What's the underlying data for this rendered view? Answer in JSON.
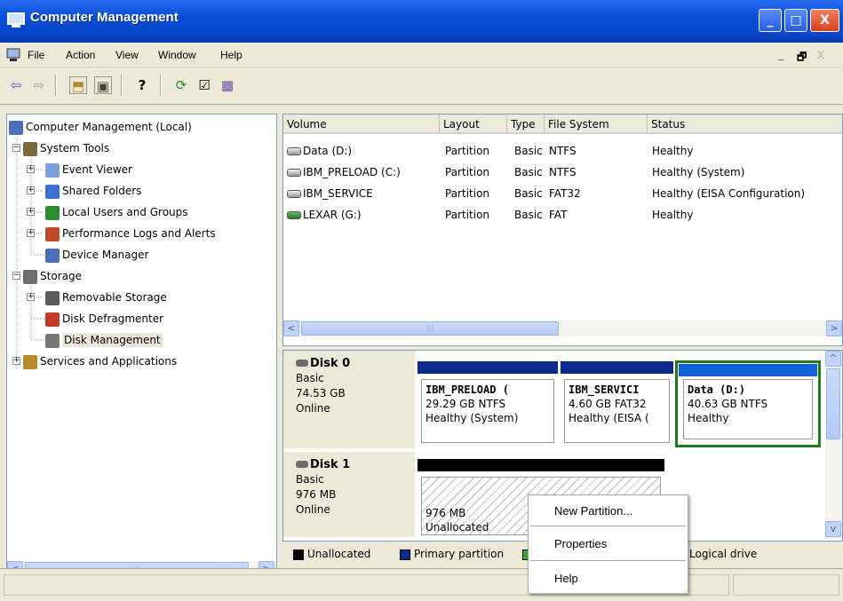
{
  "window": {
    "title": "Computer Management",
    "minimize": "_",
    "maximize": "□",
    "close": "X"
  },
  "menubar": {
    "items": [
      "File",
      "Action",
      "View",
      "Window",
      "Help"
    ],
    "mdi_min": "_",
    "mdi_restore": "🗗",
    "mdi_close": "X"
  },
  "toolbar": {
    "back": "⇦",
    "forward": "⇨",
    "up": "⬒",
    "show_hide": "▣",
    "help": "?",
    "refresh": "⟳",
    "properties": "☑",
    "disk": "▦"
  },
  "tree": {
    "items": [
      {
        "label": "Computer Management (Local)",
        "icon": "computer-icon",
        "color": "#4a6fb5"
      },
      {
        "label": "System Tools",
        "icon": "tools-icon",
        "color": "#7b6a3c"
      },
      {
        "label": "Event Viewer",
        "icon": "event-viewer-icon",
        "color": "#7aa2d8"
      },
      {
        "label": "Shared Folders",
        "icon": "shared-folder-icon",
        "color": "#3b6fd1"
      },
      {
        "label": "Local Users and Groups",
        "icon": "users-icon",
        "color": "#2e8a2e"
      },
      {
        "label": "Performance Logs and Alerts",
        "icon": "performance-icon",
        "color": "#c04a2a"
      },
      {
        "label": "Device Manager",
        "icon": "device-manager-icon",
        "color": "#4a6fb5"
      },
      {
        "label": "Storage",
        "icon": "storage-icon",
        "color": "#6d6d6d"
      },
      {
        "label": "Removable Storage",
        "icon": "removable-storage-icon",
        "color": "#5a5a5a"
      },
      {
        "label": "Disk Defragmenter",
        "icon": "defrag-icon",
        "color": "#c0392b"
      },
      {
        "label": "Disk Management",
        "icon": "disk-management-icon",
        "color": "#777"
      },
      {
        "label": "Services and Applications",
        "icon": "services-icon",
        "color": "#b58a2a"
      }
    ]
  },
  "volumes": {
    "columns": [
      "Volume",
      "Layout",
      "Type",
      "File System",
      "Status"
    ],
    "rows": [
      {
        "volume": "Data (D:)",
        "layout": "Partition",
        "type": "Basic",
        "fs": "NTFS",
        "status": "Healthy"
      },
      {
        "volume": "IBM_PRELOAD (C:)",
        "layout": "Partition",
        "type": "Basic",
        "fs": "NTFS",
        "status": "Healthy (System)"
      },
      {
        "volume": "IBM_SERVICE",
        "layout": "Partition",
        "type": "Basic",
        "fs": "FAT32",
        "status": "Healthy (EISA Configuration)"
      },
      {
        "volume": "LEXAR (G:)",
        "layout": "Partition",
        "type": "Basic",
        "fs": "FAT",
        "status": "Healthy"
      }
    ]
  },
  "disks": [
    {
      "name": "Disk 0",
      "type": "Basic",
      "size": "74.53 GB",
      "state": "Online",
      "partitions": [
        {
          "name": "IBM_PRELOAD (",
          "size": "29.29 GB NTFS",
          "status": "Healthy (System)",
          "color": "#0a2a8c"
        },
        {
          "name": "IBM_SERVICI",
          "size": "4.60 GB FAT32",
          "status": "Healthy (EISA (",
          "color": "#0a2a8c"
        },
        {
          "name": "Data  (D:)",
          "size": "40.63 GB NTFS",
          "status": "Healthy",
          "color": "#0a2a8c"
        }
      ]
    },
    {
      "name": "Disk 1",
      "type": "Basic",
      "size": "976 MB",
      "state": "Online",
      "partitions": [
        {
          "size": "976 MB",
          "status": "Unallocated",
          "color": "#000000"
        }
      ]
    }
  ],
  "legend": {
    "unallocated": "Unallocated",
    "primary": "Primary partition",
    "logical": "Logical drive",
    "colors": {
      "unallocated": "#000000",
      "primary": "#0a2a8c",
      "extended": "#2ea82e"
    }
  },
  "context_menu": {
    "items": [
      "New Partition...",
      "Properties",
      "Help"
    ]
  },
  "scroll": {
    "left": "<",
    "right": ">",
    "up": "^",
    "down": "v",
    "grip": "|||"
  }
}
